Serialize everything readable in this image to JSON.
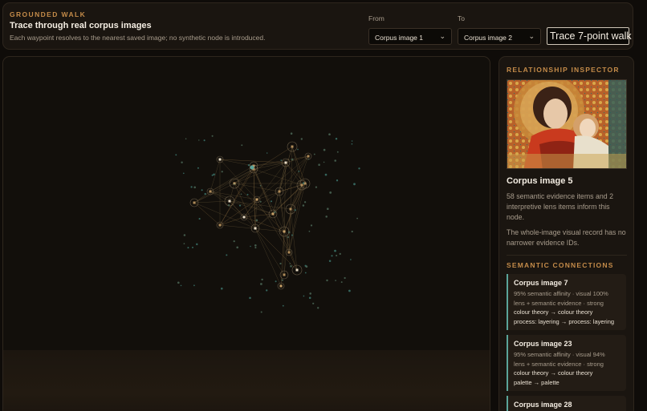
{
  "header": {
    "kicker": "GROUNDED WALK",
    "title": "Trace through real corpus images",
    "subtitle": "Each waypoint resolves to the nearest saved image; no synthetic node is introduced.",
    "from_label": "From",
    "from_value": "Corpus image 1",
    "to_label": "To",
    "to_value": "Corpus image 2",
    "trace_button": "Trace 7-point walk"
  },
  "inspector": {
    "kicker": "RELATIONSHIP INSPECTOR",
    "node_title": "Corpus image 5",
    "node_desc": "58 semantic evidence items and 2 interpretive lens items inform this node.",
    "node_note": "The whole-image visual record has no narrower evidence IDs.",
    "semantic_kicker": "SEMANTIC CONNECTIONS",
    "connections": [
      {
        "title": "Corpus image 7",
        "line1": "95% semantic affinity · visual 100%",
        "line2": "lens + semantic evidence · strong",
        "line3": "colour theory → colour theory",
        "line4": "process: layering → process: layering"
      },
      {
        "title": "Corpus image 23",
        "line1": "95% semantic affinity · visual 94%",
        "line2": "lens + semantic evidence · strong",
        "line3": "colour theory → colour theory",
        "line4": "palette → palette"
      },
      {
        "title": "Corpus image 28"
      }
    ]
  },
  "colors": {
    "accent": "#c48b49",
    "connection_rule": "#5aa59a",
    "background": "#0f0c09"
  },
  "icons": {
    "select_chevron": "chevron-down-icon"
  }
}
